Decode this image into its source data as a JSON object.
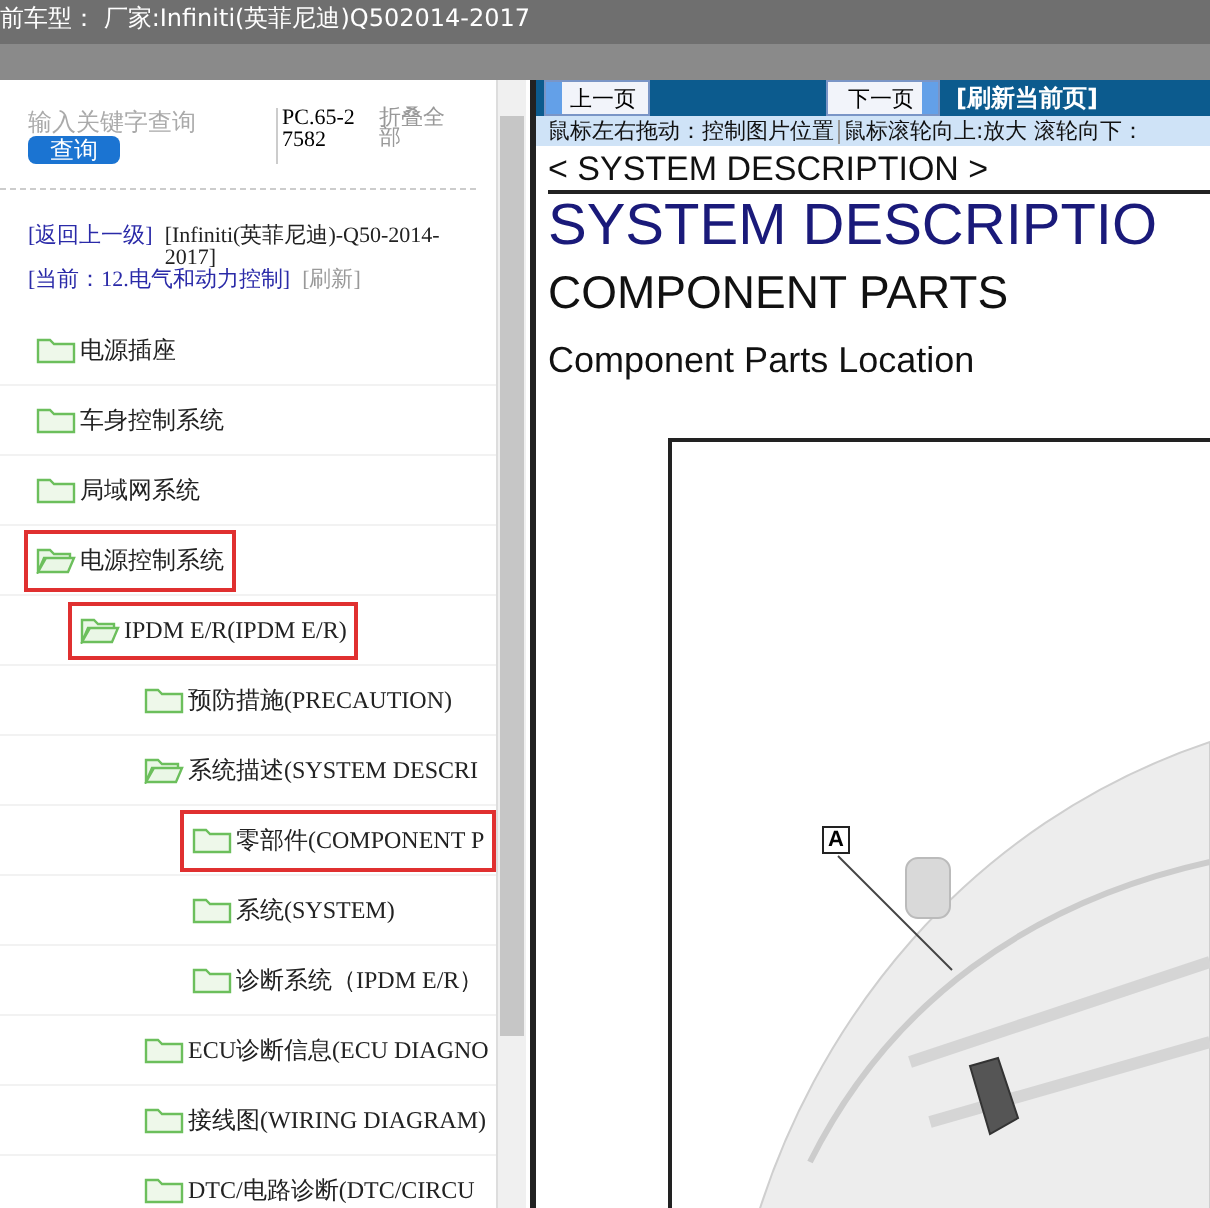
{
  "header": {
    "title": "前车型：  厂家:Infiniti(英菲尼迪)Q502014-2017"
  },
  "search": {
    "placeholder": "输入关键字查询",
    "button": "查询",
    "code": "PC.65-27582",
    "collapse": "折叠全部"
  },
  "breadcrumb": {
    "back": "[返回上一级]",
    "vehicle": "[Infiniti(英菲尼迪)-Q50-2014-2017]",
    "current": "[当前：12.电气和动力控制]",
    "refresh": "[刷新]"
  },
  "tree": [
    {
      "label": "电源插座",
      "expanded": false,
      "highlighted": false
    },
    {
      "label": "车身控制系统",
      "expanded": false,
      "highlighted": false
    },
    {
      "label": "局域网系统",
      "expanded": false,
      "highlighted": false
    },
    {
      "label": "电源控制系统",
      "expanded": true,
      "highlighted": true,
      "children": [
        {
          "label": "IPDM E/R(IPDM E/R)",
          "expanded": true,
          "highlighted": true,
          "children": [
            {
              "label": "预防措施(PRECAUTION)",
              "expanded": false,
              "highlighted": false
            },
            {
              "label": "系统描述(SYSTEM DESCRI",
              "expanded": true,
              "highlighted": false,
              "children": [
                {
                  "label": "零部件(COMPONENT P",
                  "expanded": false,
                  "highlighted": true
                },
                {
                  "label": "系统(SYSTEM)",
                  "expanded": false,
                  "highlighted": false
                },
                {
                  "label": "诊断系统（IPDM E/R）",
                  "expanded": false,
                  "highlighted": false
                }
              ]
            },
            {
              "label": "ECU诊断信息(ECU DIAGNO",
              "expanded": false,
              "highlighted": false
            },
            {
              "label": "接线图(WIRING DIAGRAM)",
              "expanded": false,
              "highlighted": false
            },
            {
              "label": "DTC/电路诊断(DTC/CIRCU",
              "expanded": false,
              "highlighted": false
            }
          ]
        }
      ]
    }
  ],
  "viewer": {
    "prev": "上一页",
    "next": "下一页",
    "refresh": "[刷新当前页]",
    "hint_1": "鼠标左右拖动：控制图片位置",
    "hint_2": "鼠标滚轮向上:放大  滚轮向下："
  },
  "document": {
    "section": "< SYSTEM DESCRIPTION >",
    "title": "SYSTEM DESCRIPTIO",
    "subtitle": "COMPONENT PARTS",
    "heading": "Component Parts Location",
    "callout": "A"
  }
}
